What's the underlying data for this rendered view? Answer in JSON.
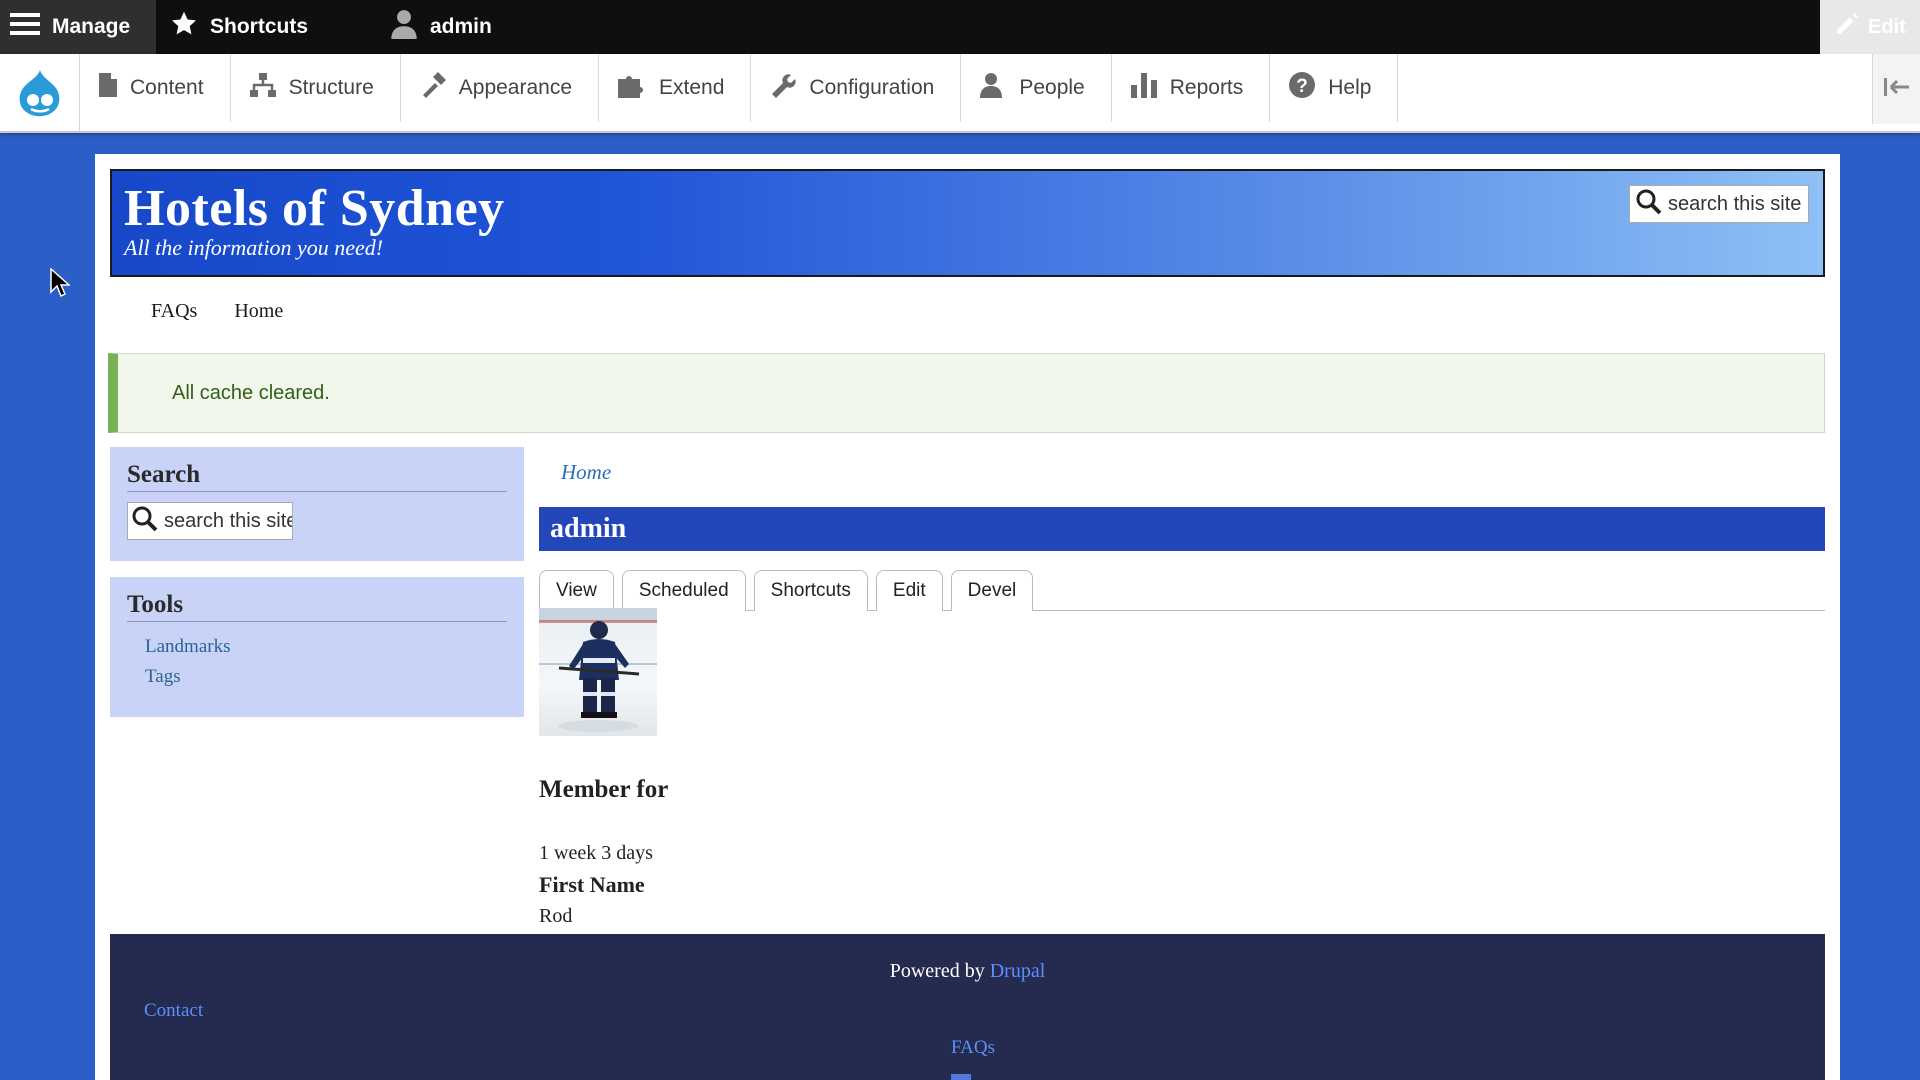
{
  "toolbar": {
    "manage_label": "Manage",
    "shortcuts_label": "Shortcuts",
    "user_label": "admin",
    "edit_label": "Edit"
  },
  "tray": {
    "items": [
      {
        "label": "Content",
        "icon": "file-icon"
      },
      {
        "label": "Structure",
        "icon": "sitemap-icon"
      },
      {
        "label": "Appearance",
        "icon": "paint-brush-icon"
      },
      {
        "label": "Extend",
        "icon": "puzzle-icon"
      },
      {
        "label": "Configuration",
        "icon": "wrench-icon"
      },
      {
        "label": "People",
        "icon": "person-icon"
      },
      {
        "label": "Reports",
        "icon": "bar-chart-icon"
      },
      {
        "label": "Help",
        "icon": "help-icon"
      }
    ]
  },
  "site": {
    "name": "Hotels of Sydney",
    "slogan": "All the information you need!",
    "search_placeholder": "search this site"
  },
  "main_nav": [
    "FAQs",
    "Home"
  ],
  "message": "All cache cleared.",
  "sidebar": {
    "search_title": "Search",
    "search_placeholder": "search this site",
    "tools_title": "Tools",
    "tools_links": [
      "Landmarks",
      "Tags"
    ]
  },
  "content": {
    "breadcrumb": "Home",
    "title": "admin",
    "tabs": [
      "View",
      "Scheduled",
      "Shortcuts",
      "Edit",
      "Devel"
    ],
    "member_for_label": "Member for",
    "member_for_value": "1 week 3 days",
    "first_name_label": "First Name",
    "first_name_value": "Rod"
  },
  "footer": {
    "powered_by": "Powered by",
    "powered_link": "Drupal",
    "contact": "Contact",
    "faqs": "FAQs"
  },
  "colors": {
    "page_background": "#2c5ec7",
    "title_bar": "#2346b9",
    "sidebar_block": "#c9d3f7",
    "footer": "#252a4f",
    "message_bg": "#f1f7ea",
    "message_accent": "#77b259"
  }
}
